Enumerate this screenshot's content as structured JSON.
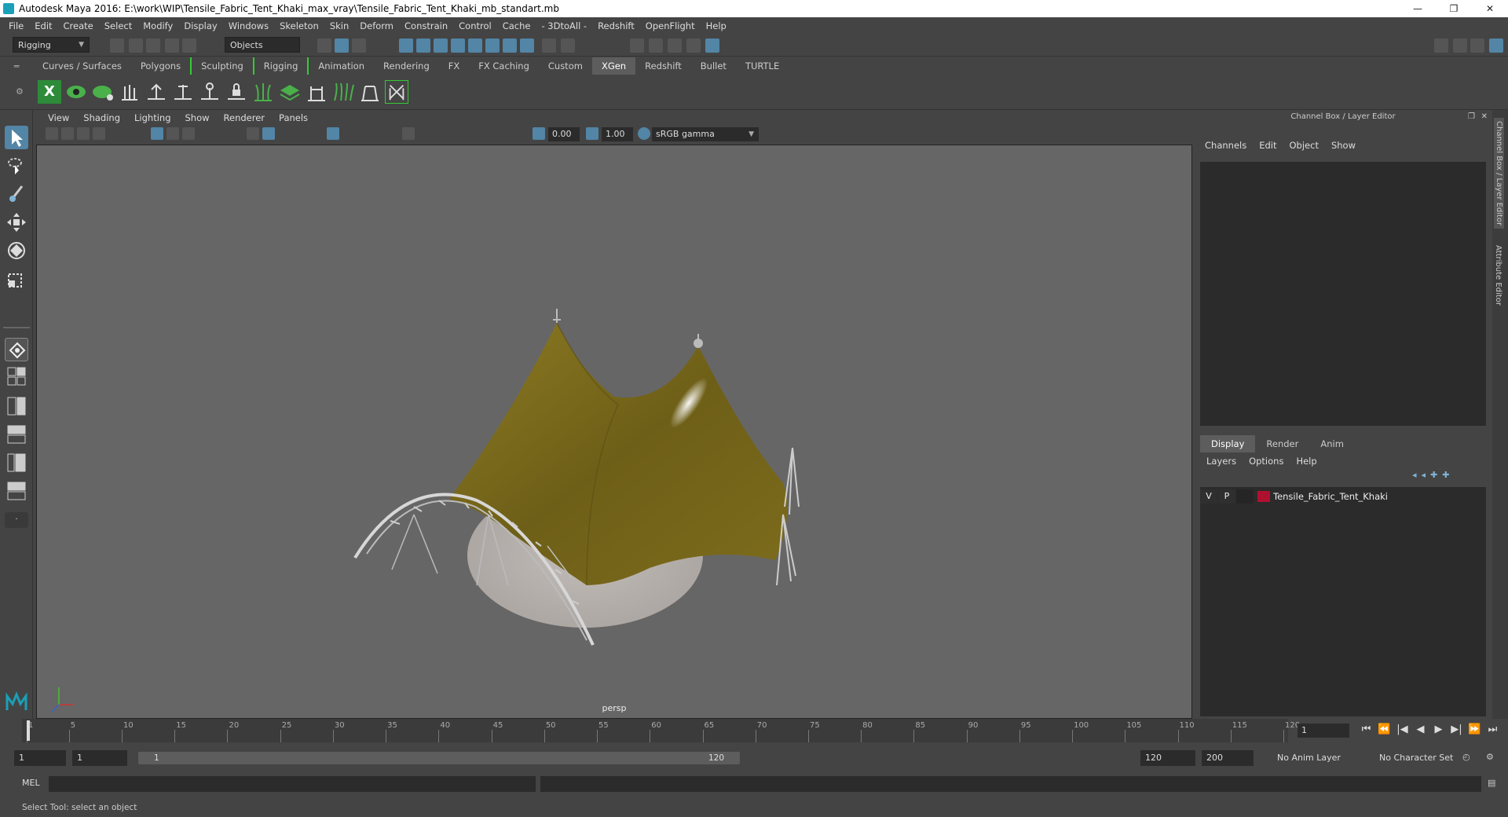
{
  "window": {
    "title": "Autodesk Maya 2016: E:\\work\\WIP\\Tensile_Fabric_Tent_Khaki_max_vray\\Tensile_Fabric_Tent_Khaki_mb_standart.mb",
    "minimize": "—",
    "maximize": "❐",
    "close": "✕"
  },
  "menubar": [
    "File",
    "Edit",
    "Create",
    "Select",
    "Modify",
    "Display",
    "Windows",
    "Skeleton",
    "Skin",
    "Deform",
    "Constrain",
    "Control",
    "Cache",
    "- 3DtoAll -",
    "Redshift",
    "OpenFlight",
    "Help"
  ],
  "status": {
    "menuset": "Rigging",
    "selection_mode": "Objects"
  },
  "shelf": {
    "tabs": [
      "Curves / Surfaces",
      "Polygons",
      "Sculpting",
      "Rigging",
      "Animation",
      "Rendering",
      "FX",
      "FX Caching",
      "Custom",
      "XGen",
      "Redshift",
      "Bullet",
      "TURTLE"
    ],
    "active": "XGen"
  },
  "viewport": {
    "menus": [
      "View",
      "Shading",
      "Lighting",
      "Show",
      "Renderer",
      "Panels"
    ],
    "exposure": "0.00",
    "gamma": "1.00",
    "color_space": "sRGB gamma",
    "camera": "persp"
  },
  "right_panel": {
    "title": "Channel Box / Layer Editor",
    "menus": [
      "Channels",
      "Edit",
      "Object",
      "Show"
    ],
    "layer_tabs": [
      "Display",
      "Render",
      "Anim"
    ],
    "layer_menus": [
      "Layers",
      "Options",
      "Help"
    ],
    "layer": {
      "v": "V",
      "p": "P",
      "name": "Tensile_Fabric_Tent_Khaki",
      "color": "#b01030"
    },
    "side_tabs": [
      "Channel Box / Layer Editor",
      "Attribute Editor"
    ]
  },
  "timeline": {
    "ticks": [
      "1",
      "5",
      "10",
      "15",
      "20",
      "25",
      "30",
      "35",
      "40",
      "45",
      "50",
      "55",
      "60",
      "65",
      "70",
      "75",
      "80",
      "85",
      "90",
      "95",
      "100",
      "105",
      "110",
      "115",
      "120"
    ],
    "current_frame": "1",
    "play_controls": [
      "⏮",
      "⏪",
      "|◀",
      "◀",
      "▶",
      "▶|",
      "⏩",
      "⏭"
    ]
  },
  "range": {
    "start": "1",
    "playback_start": "1",
    "slider_start": "1",
    "slider_end": "120",
    "playback_end": "120",
    "end": "200",
    "anim_layer": "No Anim Layer",
    "character_set": "No Character Set"
  },
  "command": {
    "label": "MEL"
  },
  "help": "Select Tool: select an object",
  "colors": {
    "accent": "#5285a6",
    "tent": "#7a6a1e",
    "floor": "#b8b2ae"
  }
}
